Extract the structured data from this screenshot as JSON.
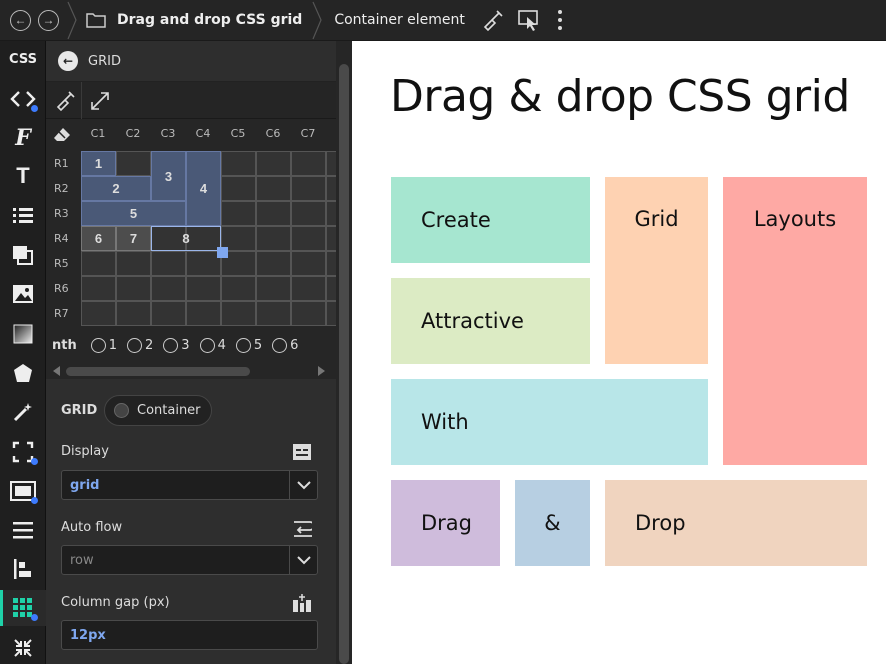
{
  "topbar": {
    "title": "Drag and drop CSS grid",
    "subtitle": "Container element"
  },
  "iconbar": {
    "css_label": "CSS",
    "accent": "#1fd1a8",
    "dot_color": "#3d7bfd"
  },
  "panel": {
    "header": "GRID",
    "columns": [
      "C1",
      "C2",
      "C3",
      "C4",
      "C5",
      "C6",
      "C7"
    ],
    "rows": [
      "R1",
      "R2",
      "R3",
      "R4",
      "R5",
      "R6",
      "R7"
    ],
    "items": [
      "1",
      "2",
      "3",
      "4",
      "5",
      "6",
      "7",
      "8"
    ],
    "nth_label": "nth",
    "nth_options": [
      "1",
      "2",
      "3",
      "4",
      "5",
      "6"
    ]
  },
  "props": {
    "grid_label": "GRID",
    "toggle_label": "Container",
    "display_label": "Display",
    "display_value": "grid",
    "autoflow_label": "Auto flow",
    "autoflow_value": "row",
    "colgap_label": "Column gap (px)",
    "colgap_value": "12px"
  },
  "canvas": {
    "title": "Drag & drop CSS grid",
    "boxes": [
      {
        "label": "Create",
        "color": "#a6e6d0"
      },
      {
        "label": "Grid",
        "color": "#fed2b2"
      },
      {
        "label": "Layouts",
        "color": "#fea9a4"
      },
      {
        "label": "Attractive",
        "color": "#dcebc4"
      },
      {
        "label": "With",
        "color": "#b8e6e8"
      },
      {
        "label": "Drag",
        "color": "#cfbcdc"
      },
      {
        "label": "&",
        "color": "#b7cfe2"
      },
      {
        "label": "Drop",
        "color": "#f0d4bf"
      }
    ]
  }
}
